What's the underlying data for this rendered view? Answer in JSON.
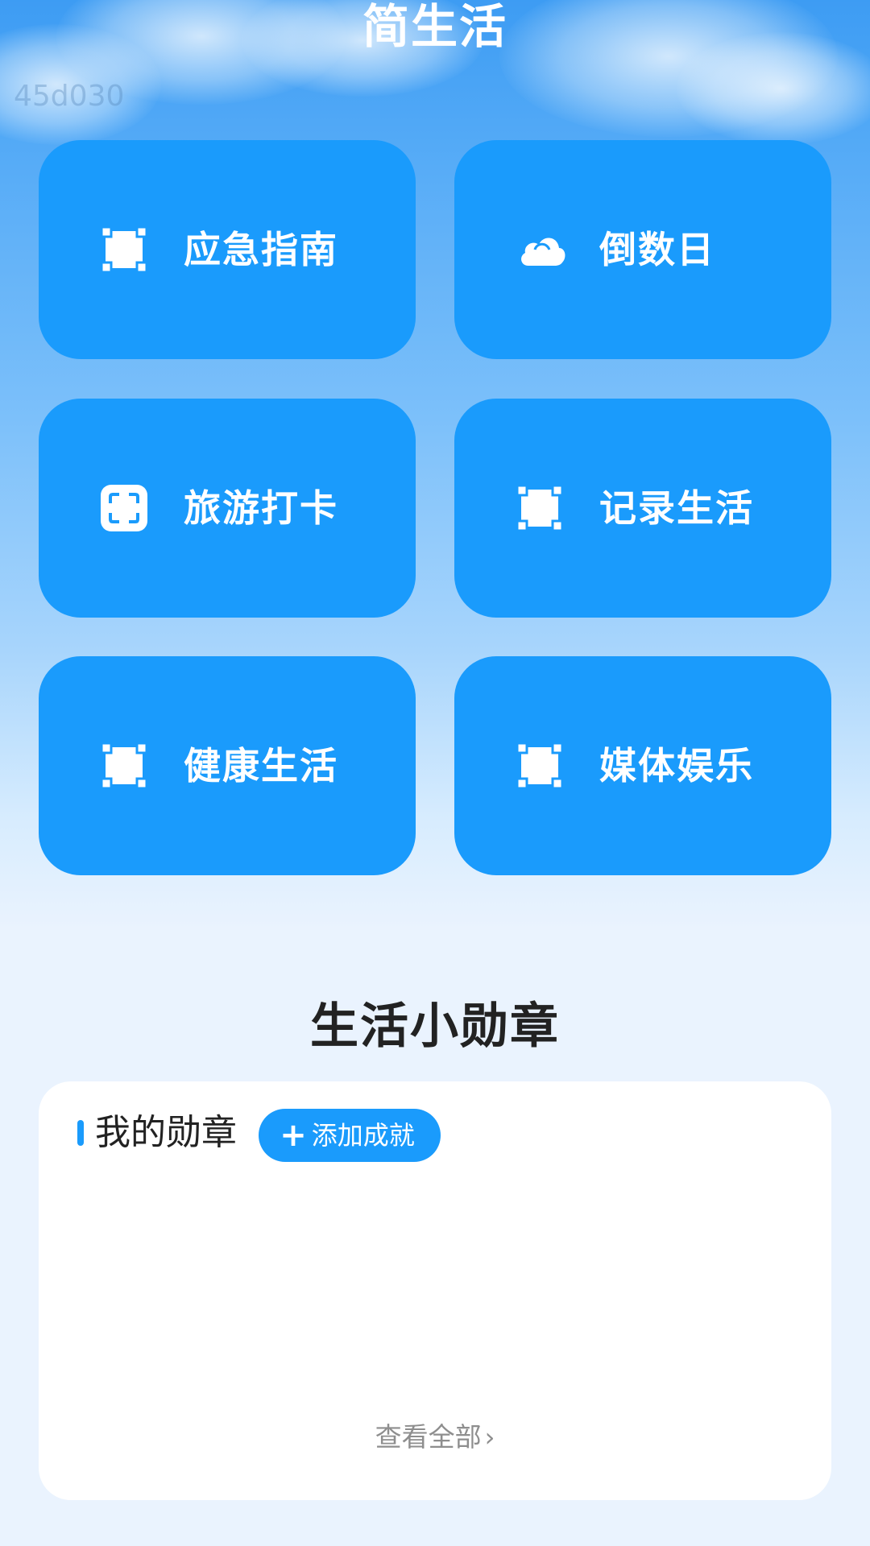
{
  "header": {
    "title": "简生活",
    "watermark": "45d030"
  },
  "tiles": [
    {
      "label": "应急指南",
      "icon": "square-corners-icon"
    },
    {
      "label": "倒数日",
      "icon": "cloud-icon"
    },
    {
      "label": "旅游打卡",
      "icon": "scan-frame-icon"
    },
    {
      "label": "记录生活",
      "icon": "square-corners-icon"
    },
    {
      "label": "健康生活",
      "icon": "square-corners-icon"
    },
    {
      "label": "媒体娱乐",
      "icon": "square-corners-icon"
    }
  ],
  "badges": {
    "section_title": "生活小勋章",
    "heading": "我的勋章",
    "add_button_icon": "+",
    "add_button_label": "添加成就",
    "view_all_label": "查看全部",
    "view_all_icon": "›"
  },
  "colors": {
    "accent": "#1a9bfc",
    "tile_text": "#ffffff",
    "page_bg": "#eaf3fe"
  }
}
